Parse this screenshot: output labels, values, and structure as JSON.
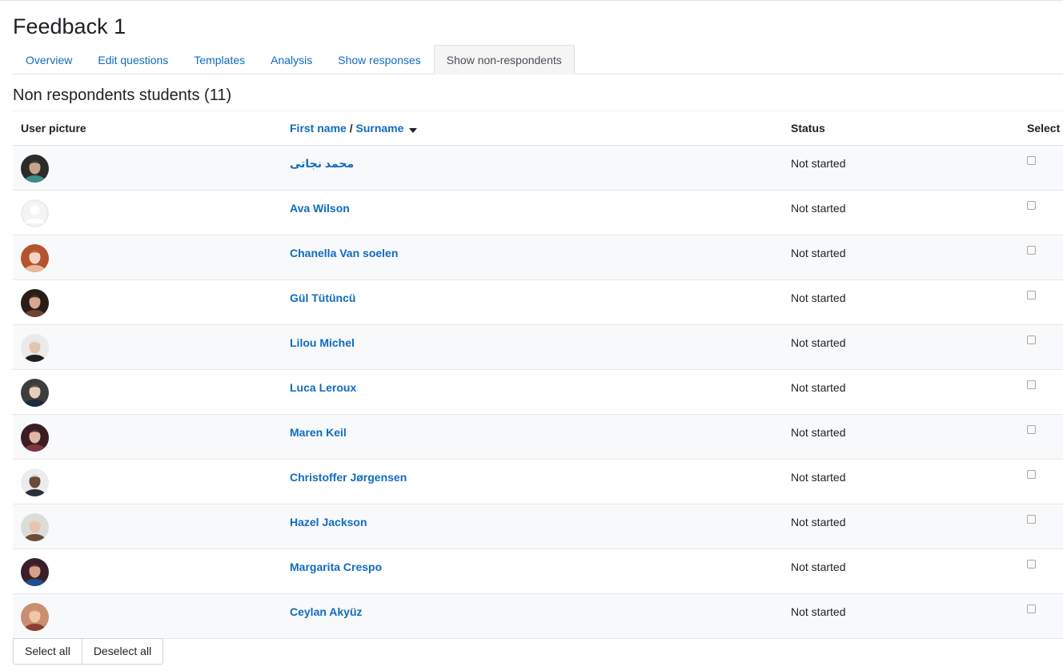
{
  "page": {
    "title": "Feedback 1",
    "subtitle": "Non respondents students (11)"
  },
  "tabs": [
    {
      "label": "Overview",
      "active": false
    },
    {
      "label": "Edit questions",
      "active": false
    },
    {
      "label": "Templates",
      "active": false
    },
    {
      "label": "Analysis",
      "active": false
    },
    {
      "label": "Show responses",
      "active": false
    },
    {
      "label": "Show non-respondents",
      "active": true
    }
  ],
  "table": {
    "headers": {
      "picture": "User picture",
      "firstname": "First name",
      "separator": " / ",
      "surname": "Surname",
      "status": "Status",
      "select": "Select"
    },
    "rows": [
      {
        "name": "محمد نجاتی",
        "status": "Not started",
        "avatar": "photo",
        "palette": [
          "#2b2b2b",
          "#3a8f86",
          "#c9a48c"
        ]
      },
      {
        "name": "Ava Wilson",
        "status": "Not started",
        "avatar": "default",
        "palette": [
          "#ebebeb",
          "#ffffff",
          "#ffffff"
        ]
      },
      {
        "name": "Chanella Van soelen",
        "status": "Not started",
        "avatar": "photo",
        "palette": [
          "#b4532e",
          "#e9b79a",
          "#f3d6c2"
        ]
      },
      {
        "name": "Gül Tütüncü",
        "status": "Not started",
        "avatar": "photo",
        "palette": [
          "#2a1d18",
          "#6e4535",
          "#d8a98e"
        ]
      },
      {
        "name": "Lilou Michel",
        "status": "Not started",
        "avatar": "photo",
        "palette": [
          "#eaeaea",
          "#1f1f1f",
          "#e3c4b0"
        ]
      },
      {
        "name": "Luca Leroux",
        "status": "Not started",
        "avatar": "photo",
        "palette": [
          "#3d3d3d",
          "#1c2a3a",
          "#e8cdbd"
        ]
      },
      {
        "name": "Maren Keil",
        "status": "Not started",
        "avatar": "photo",
        "palette": [
          "#3a1d22",
          "#7b3744",
          "#e3b7a6"
        ]
      },
      {
        "name": "Christoffer Jørgensen",
        "status": "Not started",
        "avatar": "photo",
        "palette": [
          "#ececec",
          "#2b2f38",
          "#6b4a38"
        ]
      },
      {
        "name": "Hazel Jackson",
        "status": "Not started",
        "avatar": "photo",
        "palette": [
          "#dcdcd8",
          "#6b4b3a",
          "#e6c4ae"
        ]
      },
      {
        "name": "Margarita Crespo",
        "status": "Not started",
        "avatar": "photo",
        "palette": [
          "#3a1f2a",
          "#1f4f8a",
          "#d8a08a"
        ]
      },
      {
        "name": "Ceylan Akyüz",
        "status": "Not started",
        "avatar": "photo",
        "palette": [
          "#c98f70",
          "#8a3f2f",
          "#f0c7a8"
        ]
      }
    ]
  },
  "buttons": {
    "select_all": "Select all",
    "deselect_all": "Deselect all"
  },
  "colors": {
    "link": "#0f6cbf",
    "text": "#1d2125",
    "active_tab_bg": "#f5f5f5",
    "stripe_bg": "#f8f9fa"
  }
}
